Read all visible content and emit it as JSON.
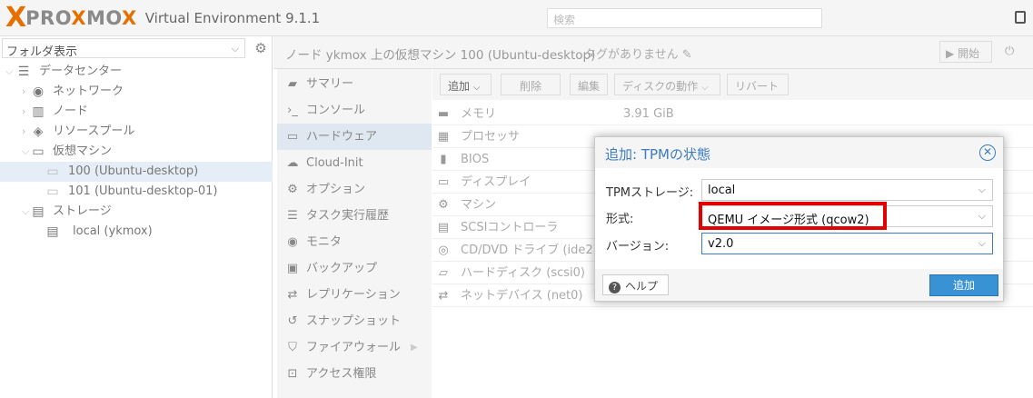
{
  "app": {
    "brand_x": "X",
    "brand_word_1": "PRO",
    "brand_word_x": "X",
    "brand_word_2": "MO",
    "brand_word_3": "X",
    "version": "Virtual Environment 9.1.1",
    "search_placeholder": "検索",
    "accent_color": "#e57000"
  },
  "sidebar": {
    "view_selector": "フォルダ表示",
    "tree": [
      {
        "label": "データセンター",
        "icon": "server-icon"
      },
      {
        "label": "ネットワーク",
        "icon": "globe-icon"
      },
      {
        "label": "ノード",
        "icon": "building-icon"
      },
      {
        "label": "リソースプール",
        "icon": "tags-icon"
      },
      {
        "label": "仮想マシン",
        "icon": "desktop-icon"
      },
      {
        "label": "100 (Ubuntu-desktop)",
        "icon": "vm-icon"
      },
      {
        "label": "101 (Ubuntu-desktop-01)",
        "icon": "vm-icon"
      },
      {
        "label": "ストレージ",
        "icon": "database-icon"
      },
      {
        "label": "local (ykmox)",
        "icon": "storage-icon"
      }
    ]
  },
  "header": {
    "title": "ノード ykmox 上の仮想マシン 100 (Ubuntu-desktop)",
    "tags": "タグがありません",
    "start_label": "開始"
  },
  "nav": {
    "items": [
      {
        "label": "サマリー",
        "icon": "book-icon"
      },
      {
        "label": "コンソール",
        "icon": "terminal-icon"
      },
      {
        "label": "ハードウェア",
        "icon": "desktop-icon"
      },
      {
        "label": "Cloud-Init",
        "icon": "cloud-icon"
      },
      {
        "label": "オプション",
        "icon": "gear-icon"
      },
      {
        "label": "タスク実行履歴",
        "icon": "list-icon"
      },
      {
        "label": "モニタ",
        "icon": "eye-icon"
      },
      {
        "label": "バックアップ",
        "icon": "floppy-icon"
      },
      {
        "label": "レプリケーション",
        "icon": "retweet-icon"
      },
      {
        "label": "スナップショット",
        "icon": "history-icon"
      },
      {
        "label": "ファイアウォール",
        "icon": "shield-icon"
      },
      {
        "label": "アクセス権限",
        "icon": "unlock-icon"
      }
    ]
  },
  "toolbar": {
    "add": "追加",
    "remove": "削除",
    "edit": "編集",
    "disk_action": "ディスクの動作",
    "revert": "リバート"
  },
  "hardware": {
    "rows": [
      {
        "key": "メモリ",
        "value": "3.91 GiB",
        "icon": "memory-icon"
      },
      {
        "key": "プロセッサ",
        "value": "",
        "icon": "cpu-icon"
      },
      {
        "key": "BIOS",
        "value": "",
        "icon": "microchip-icon"
      },
      {
        "key": "ディスプレイ",
        "value": "",
        "icon": "monitor-icon"
      },
      {
        "key": "マシン",
        "value": "",
        "icon": "cogs-icon"
      },
      {
        "key": "SCSIコントローラ",
        "value": "",
        "icon": "database-icon"
      },
      {
        "key": "CD/DVD ドライブ (ide2)",
        "value": "",
        "icon": "cdrom-icon"
      },
      {
        "key": "ハードディスク (scsi0)",
        "value": "",
        "icon": "hdd-icon"
      },
      {
        "key": "ネットデバイス (net0)",
        "value": "",
        "icon": "exchange-icon"
      }
    ]
  },
  "dialog": {
    "title": "追加: TPMの状態",
    "storage_label": "TPMストレージ:",
    "storage_value": "local",
    "format_label": "形式:",
    "format_value": "QEMU イメージ形式 (qcow2)",
    "version_label": "バージョン:",
    "version_value": "v2.0",
    "help": "ヘルプ",
    "add": "追加",
    "highlight_color": "#e30000"
  }
}
